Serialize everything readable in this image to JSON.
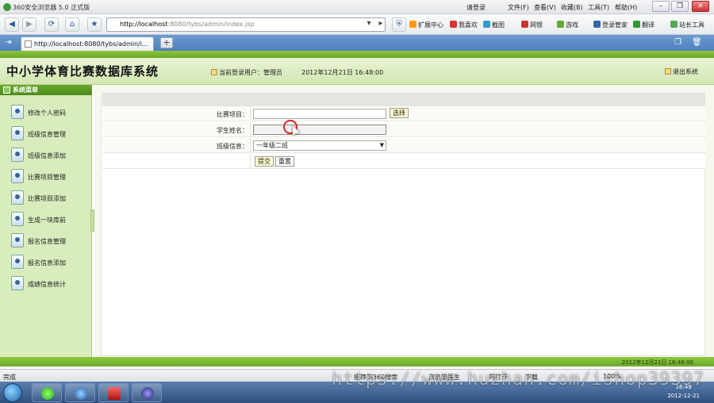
{
  "browser": {
    "title": "360安全浏览器 5.0 正式版",
    "menu": [
      "请登录",
      "文件(F)",
      "查看(V)",
      "收藏(B)",
      "工具(T)",
      "帮助(H)"
    ],
    "address_host": "http://localhost",
    "address_rest": ":8080/tybs/admin/index.jsp",
    "toolbar": [
      "扩展中心",
      "我喜欢",
      "截图",
      "网银",
      "游戏",
      "登录管家",
      "翻译",
      "站长工具"
    ],
    "tab_label": "http://localhost:8080/tybs/admin/i...",
    "new_tab": "+",
    "status_text": "完成",
    "status_items": [
      "推荐到360搜索",
      "浏览器医生",
      "同打开",
      "下载",
      "100%"
    ]
  },
  "header": {
    "site_title": "中小学体育比赛数据库系统",
    "user_info": "当前登录用户：管理员",
    "datetime": "2012年12月21日  16:48:00",
    "logout": "退出系统"
  },
  "sidebar": {
    "heading": "系统菜单",
    "items": [
      {
        "label": "修改个人密码"
      },
      {
        "label": "班级信息管理"
      },
      {
        "label": "班级信息添加"
      },
      {
        "label": "比赛项目管理"
      },
      {
        "label": "比赛项目添加"
      },
      {
        "label": "生成一块库前"
      },
      {
        "label": "报名信息管理"
      },
      {
        "label": "报名信息添加"
      },
      {
        "label": "成绩信息统计"
      }
    ]
  },
  "form": {
    "project_label": "比赛项目：",
    "project_value": "",
    "choose_button": "选择",
    "student_label": "学生姓名：",
    "student_value": "",
    "class_label": "班级信息：",
    "class_selected": "一年级二班",
    "submit_button": "提交",
    "reset_button": "重置"
  },
  "footer": {
    "date": "2012年12月21日  16:48:00"
  },
  "taskbar": {
    "time": "16:49",
    "date": "2012-12-21"
  },
  "watermark": "https://www.huzhan.com/ishop39397",
  "colors": {
    "accent_green": "#6aa82a",
    "sidebar_bg": "#d9ecbc",
    "header_bg": "#e9f3d6"
  }
}
